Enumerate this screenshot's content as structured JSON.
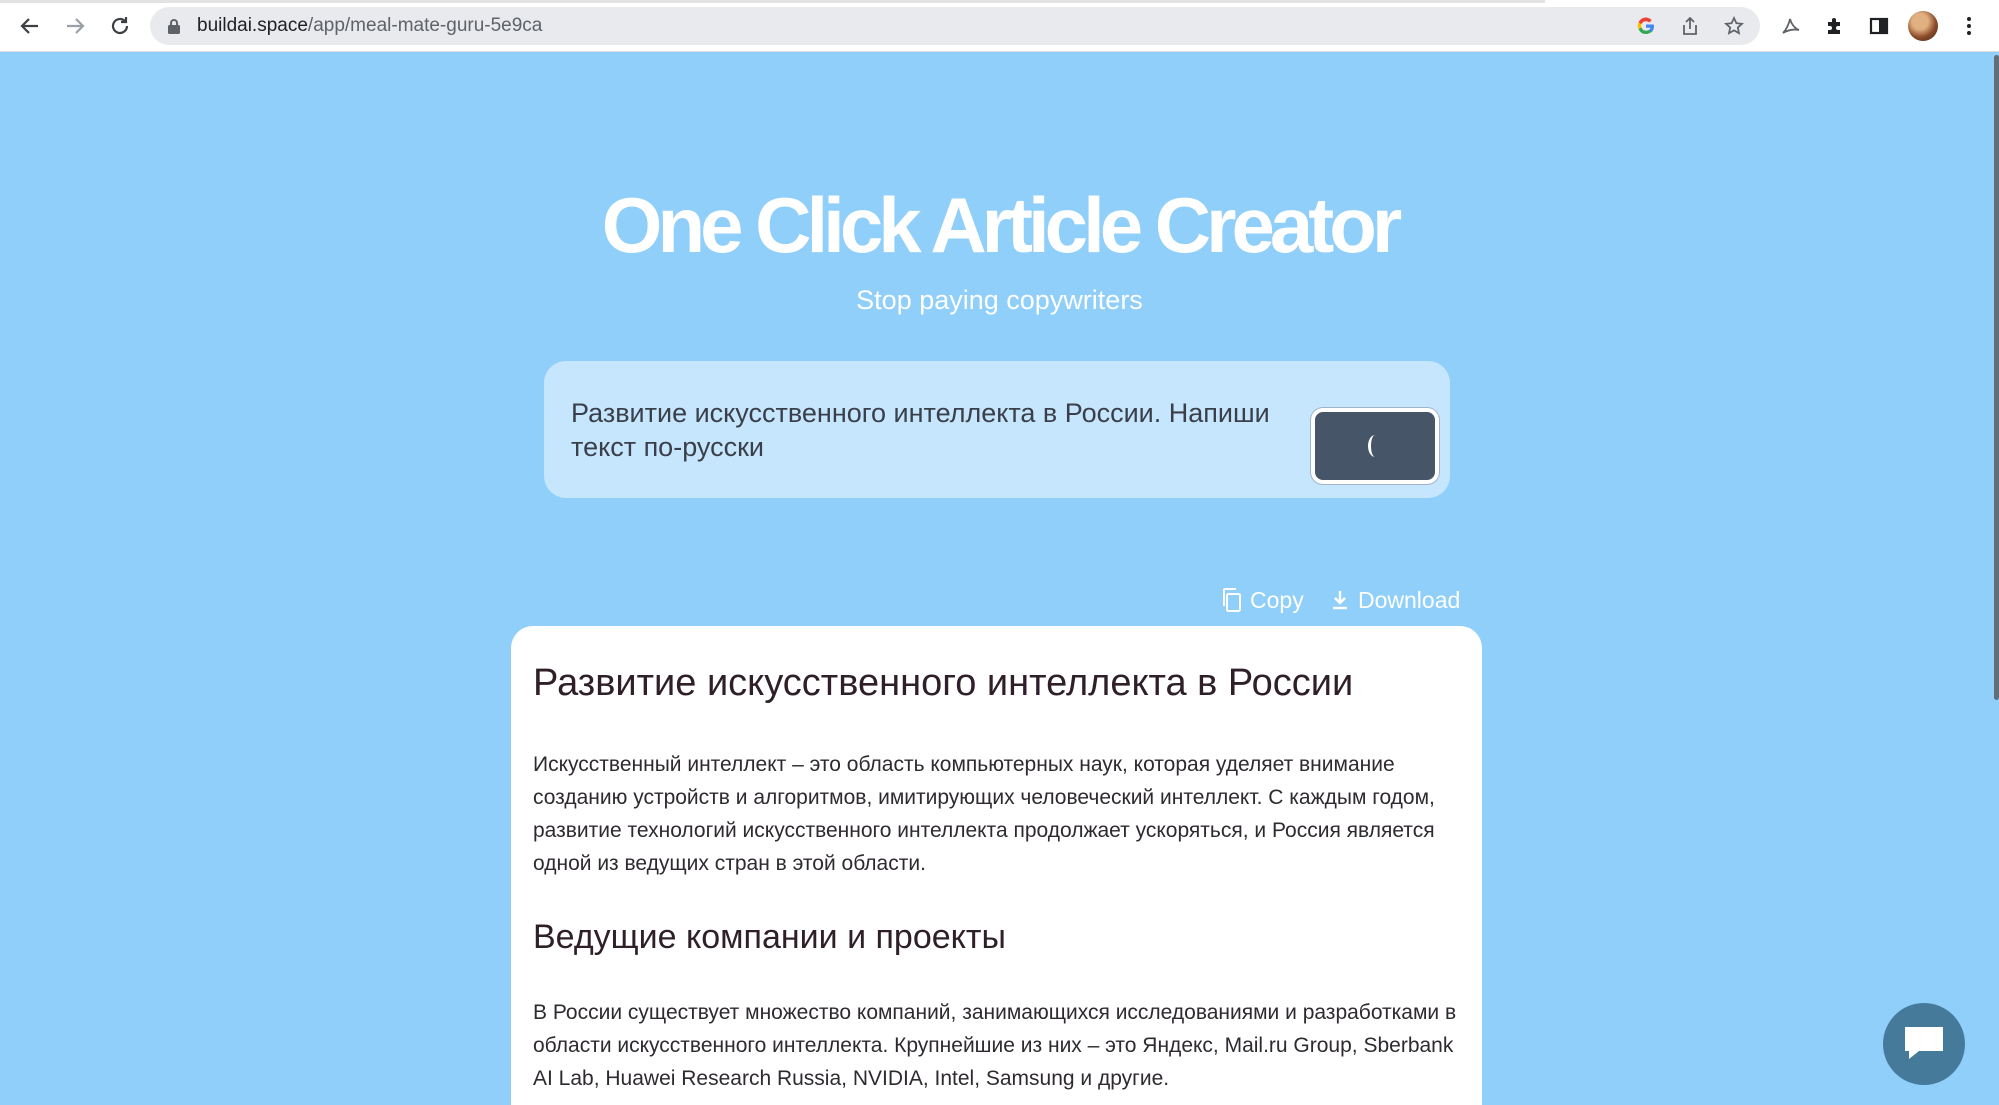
{
  "browser": {
    "url_domain": "buildai.space",
    "url_path": "/app/meal-mate-guru-5e9ca"
  },
  "hero": {
    "title": "One Click Article Creator",
    "subtitle": "Stop paying copywriters"
  },
  "prompt": {
    "text": "Развитие искусственного интеллекта в России. Напиши текст по-русски"
  },
  "actions": {
    "copy_label": "Copy",
    "download_label": "Download"
  },
  "article": {
    "title": "Развитие искусственного интеллекта в России",
    "paragraph_1": "Искусственный интеллект – это область компьютерных наук, которая уделяет внимание созданию устройств и алгоритмов, имитирующих человеческий интеллект. С каждым годом, развитие технологий искусственного интеллекта продолжает ускоряться, и Россия является одной из ведущих стран в этой области.",
    "section_title": "Ведущие компании и проекты",
    "paragraph_2": "В России существует множество компаний, занимающихся исследованиями и разработками в области искусственного интеллекта. Крупнейшие из них – это Яндекс, Mail.ru Group, Sberbank AI Lab, Huawei Research Russia, NVIDIA, Intel, Samsung и другие."
  },
  "colors": {
    "page_background": "#8fcffa",
    "prompt_card": "#c6e6fd",
    "generate_button": "#475569",
    "chat_bubble": "#467a9b"
  },
  "icons": [
    "back-arrow-icon",
    "forward-arrow-icon",
    "reload-icon",
    "lock-icon",
    "google-icon",
    "share-icon",
    "star-icon",
    "acrobat-icon",
    "puzzle-icon",
    "side-panel-icon",
    "kebab-menu-icon",
    "copy-icon",
    "download-icon",
    "chat-icon"
  ]
}
